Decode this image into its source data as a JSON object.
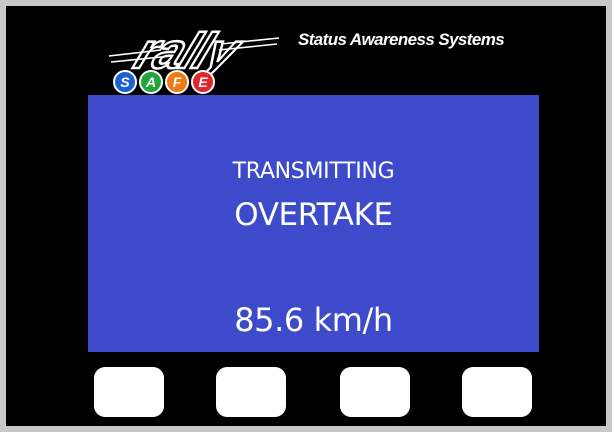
{
  "brand": {
    "logo_text": "rally",
    "badge_letters": [
      "S",
      "A",
      "F",
      "E"
    ],
    "badge_colors": [
      "#1e5fd8",
      "#23a43c",
      "#f07a14",
      "#e3262b"
    ],
    "tagline": "Status Awareness Systems"
  },
  "display": {
    "status": "TRANSMITTING",
    "message": "OVERTAKE",
    "speed": "85.6 km/h",
    "background_color": "#3d4bcb"
  },
  "buttons": {
    "count": 4,
    "color": "#ffffff"
  }
}
